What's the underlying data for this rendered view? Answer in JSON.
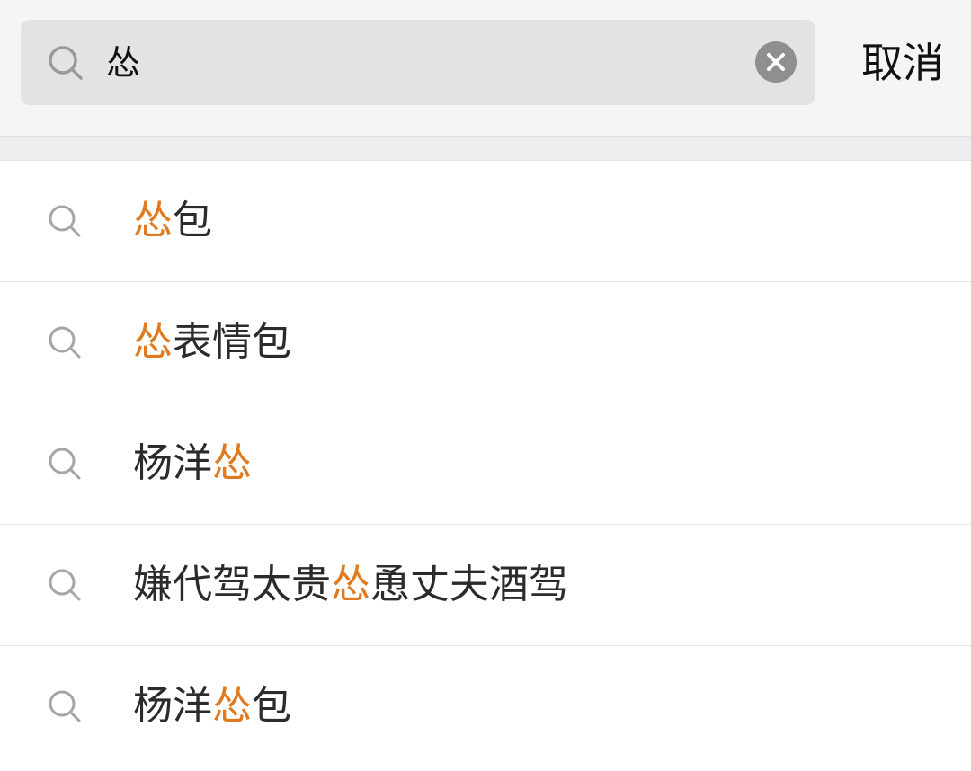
{
  "search": {
    "query": "怂",
    "icon": "search-icon",
    "clear_icon": "clear-icon",
    "cancel_label": "取消"
  },
  "colors": {
    "highlight": "#e07a1f",
    "text": "#2b2b2b",
    "search_bg": "#e3e3e5"
  },
  "suggestions": [
    {
      "parts": [
        {
          "text": "怂",
          "hl": true
        },
        {
          "text": "包",
          "hl": false
        }
      ]
    },
    {
      "parts": [
        {
          "text": "怂",
          "hl": true
        },
        {
          "text": "表情包",
          "hl": false
        }
      ]
    },
    {
      "parts": [
        {
          "text": "杨洋",
          "hl": false
        },
        {
          "text": "怂",
          "hl": true
        }
      ]
    },
    {
      "parts": [
        {
          "text": "嫌代驾太贵",
          "hl": false
        },
        {
          "text": "怂",
          "hl": true
        },
        {
          "text": "恿丈夫酒驾",
          "hl": false
        }
      ]
    },
    {
      "parts": [
        {
          "text": "杨洋",
          "hl": false
        },
        {
          "text": "怂",
          "hl": true
        },
        {
          "text": "包",
          "hl": false
        }
      ]
    }
  ]
}
